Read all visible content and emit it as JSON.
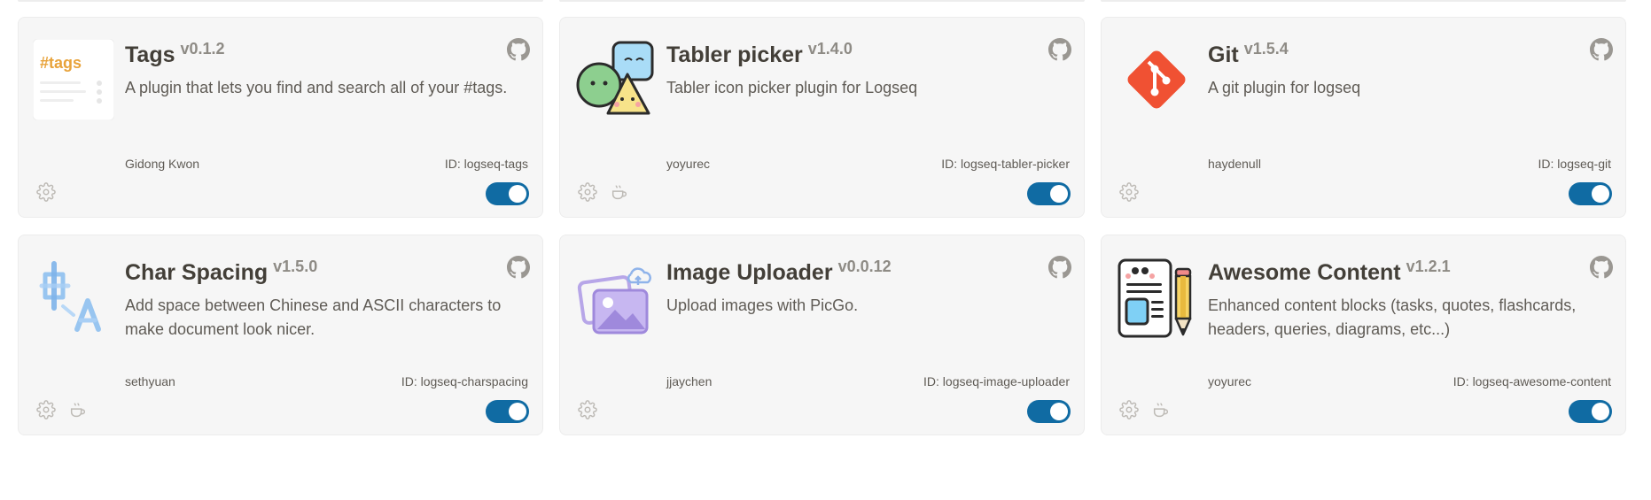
{
  "colors": {
    "card_bg": "#f6f6f6",
    "toggle_on": "#106ba3",
    "title": "#433f38",
    "muted": "#8e8b85"
  },
  "plugins": [
    {
      "title": "Tags",
      "version": "v0.1.2",
      "description": "A plugin that lets you find and search all of your #tags.",
      "author": "Gidong Kwon",
      "id_label": "ID: logseq-tags",
      "icon": "tags-icon",
      "icon_text": "#tags",
      "enabled": true,
      "has_sponsor": false
    },
    {
      "title": "Tabler picker",
      "version": "v1.4.0",
      "description": "Tabler icon picker plugin for Logseq",
      "author": "yoyurec",
      "id_label": "ID: logseq-tabler-picker",
      "icon": "tabler-shapes-icon",
      "enabled": true,
      "has_sponsor": true
    },
    {
      "title": "Git",
      "version": "v1.5.4",
      "description": "A git plugin for logseq",
      "author": "haydenull",
      "id_label": "ID: logseq-git",
      "icon": "git-icon",
      "enabled": true,
      "has_sponsor": false
    },
    {
      "title": "Char Spacing",
      "version": "v1.5.0",
      "description": "Add space between Chinese and ASCII characters to make document look nicer.",
      "author": "sethyuan",
      "id_label": "ID: logseq-charspacing",
      "icon": "char-spacing-icon",
      "enabled": true,
      "has_sponsor": true
    },
    {
      "title": "Image Uploader",
      "version": "v0.0.12",
      "description": "Upload images with PicGo.",
      "author": "jjaychen",
      "id_label": "ID: logseq-image-uploader",
      "icon": "image-upload-icon",
      "enabled": true,
      "has_sponsor": false
    },
    {
      "title": "Awesome Content",
      "version": "v1.2.1",
      "description": "Enhanced content blocks (tasks, quotes, flashcards, headers, queries, diagrams, etc...)",
      "author": "yoyurec",
      "id_label": "ID: logseq-awesome-content",
      "icon": "notebook-pencil-icon",
      "enabled": true,
      "has_sponsor": true
    }
  ]
}
